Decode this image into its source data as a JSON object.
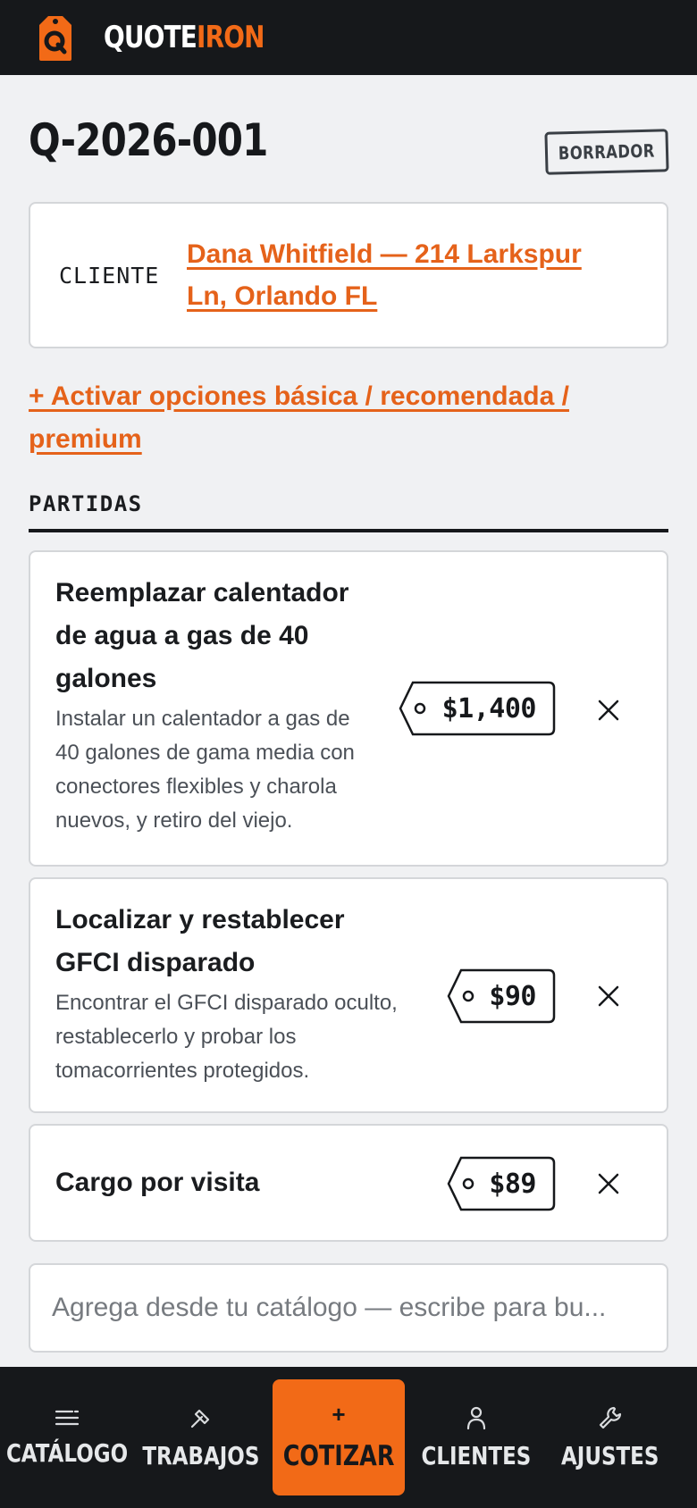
{
  "header": {
    "logo_icon": "price-tag-q-logo",
    "brand_part1": "QUOTE",
    "brand_part2": "IRON",
    "accent_color": "#f26a17"
  },
  "quote": {
    "id": "Q-2026-001",
    "status": "BORRADOR"
  },
  "client": {
    "label": "CLIENTE",
    "value": "Dana Whitfield — 214 Larkspur Ln, Orlando FL"
  },
  "options_link": "+ Activar opciones básica / recomendada / premium",
  "line_items": {
    "heading": "PARTIDAS",
    "items": [
      {
        "title": "Reemplazar calentador de agua a gas de 40 galones",
        "description": "Instalar un calentador a gas de 40 galones de gama media con conectores flexibles y charola nuevos, y retiro del viejo.",
        "price": "$1,400"
      },
      {
        "title": "Localizar y restablecer GFCI disparado",
        "description": "Encontrar el GFCI disparado oculto, restablecerlo y probar los tomacorrientes protegidos.",
        "price": "$90"
      },
      {
        "title": "Cargo por visita",
        "description": "",
        "price": "$89"
      }
    ]
  },
  "catalog_search": {
    "placeholder": "Agrega desde tu catálogo — escribe para bu..."
  },
  "nav": {
    "catalog": "CATÁLOGO",
    "jobs": "TRABAJOS",
    "quote_plus": "+",
    "quote": "COTIZAR",
    "clients": "CLIENTES",
    "settings": "AJUSTES"
  }
}
